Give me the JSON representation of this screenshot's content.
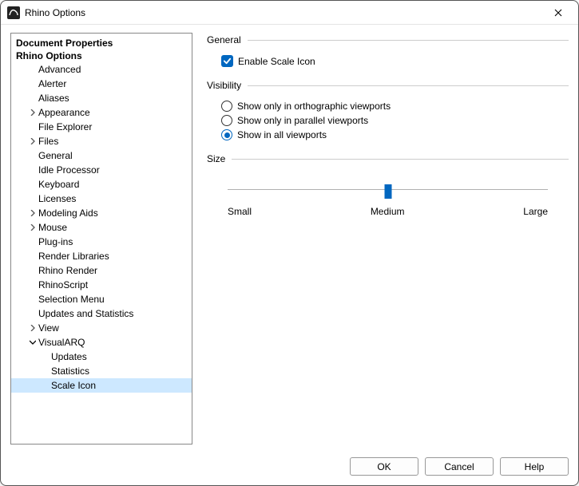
{
  "window": {
    "title": "Rhino Options"
  },
  "tree": {
    "heading1": "Document Properties",
    "heading2": "Rhino Options",
    "items": [
      {
        "label": "Advanced",
        "indent": 2,
        "expandable": false
      },
      {
        "label": "Alerter",
        "indent": 2,
        "expandable": false
      },
      {
        "label": "Aliases",
        "indent": 2,
        "expandable": false
      },
      {
        "label": "Appearance",
        "indent": 2,
        "expandable": true,
        "expanded": false
      },
      {
        "label": "File Explorer",
        "indent": 2,
        "expandable": false
      },
      {
        "label": "Files",
        "indent": 2,
        "expandable": true,
        "expanded": false
      },
      {
        "label": "General",
        "indent": 2,
        "expandable": false
      },
      {
        "label": "Idle Processor",
        "indent": 2,
        "expandable": false
      },
      {
        "label": "Keyboard",
        "indent": 2,
        "expandable": false
      },
      {
        "label": "Licenses",
        "indent": 2,
        "expandable": false
      },
      {
        "label": "Modeling Aids",
        "indent": 2,
        "expandable": true,
        "expanded": false
      },
      {
        "label": "Mouse",
        "indent": 2,
        "expandable": true,
        "expanded": false
      },
      {
        "label": "Plug-ins",
        "indent": 2,
        "expandable": false
      },
      {
        "label": "Render Libraries",
        "indent": 2,
        "expandable": false
      },
      {
        "label": "Rhino Render",
        "indent": 2,
        "expandable": false
      },
      {
        "label": "RhinoScript",
        "indent": 2,
        "expandable": false
      },
      {
        "label": "Selection Menu",
        "indent": 2,
        "expandable": false
      },
      {
        "label": "Updates and Statistics",
        "indent": 2,
        "expandable": false
      },
      {
        "label": "View",
        "indent": 2,
        "expandable": true,
        "expanded": false
      },
      {
        "label": "VisualARQ",
        "indent": 2,
        "expandable": true,
        "expanded": true
      },
      {
        "label": "Updates",
        "indent": 3,
        "expandable": false
      },
      {
        "label": "Statistics",
        "indent": 3,
        "expandable": false
      },
      {
        "label": "Scale Icon",
        "indent": 3,
        "expandable": false,
        "selected": true
      }
    ]
  },
  "panel": {
    "general": {
      "legend": "General",
      "enable_label": "Enable Scale Icon",
      "enable_checked": true
    },
    "visibility": {
      "legend": "Visibility",
      "options": [
        {
          "label": "Show only in orthographic viewports",
          "checked": false
        },
        {
          "label": "Show only in parallel viewports",
          "checked": false
        },
        {
          "label": "Show in all viewports",
          "checked": true
        }
      ]
    },
    "size": {
      "legend": "Size",
      "value": 50,
      "labels": {
        "min": "Small",
        "mid": "Medium",
        "max": "Large"
      }
    }
  },
  "buttons": {
    "ok": "OK",
    "cancel": "Cancel",
    "help": "Help"
  }
}
